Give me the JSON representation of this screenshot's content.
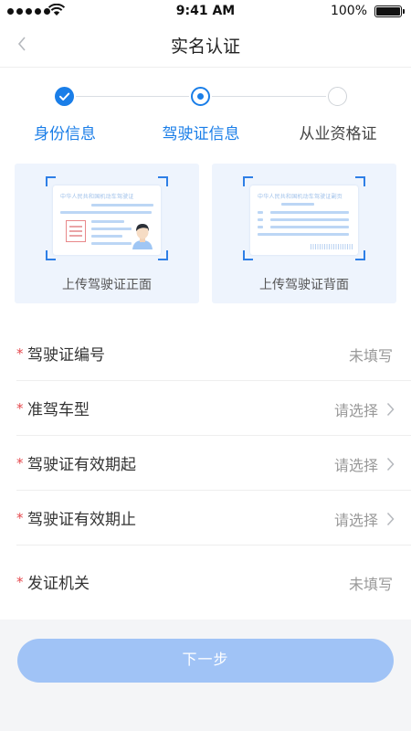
{
  "status_bar": {
    "time": "9:41 AM",
    "battery_text": "100%",
    "battery_level": 1.0,
    "signal_icon": "signal-dots-icon",
    "wifi_icon": "wifi-icon"
  },
  "nav": {
    "title": "实名认证",
    "back_icon": "chevron-left-icon"
  },
  "steps": [
    {
      "label": "身份信息",
      "state": "done"
    },
    {
      "label": "驾驶证信息",
      "state": "current"
    },
    {
      "label": "从业资格证",
      "state": "todo"
    }
  ],
  "uploads": {
    "front_label": "上传驾驶证正面",
    "back_label": "上传驾驶证背面",
    "front_card_title": "中华人民共和国机动车驾驶证",
    "back_card_title": "中华人民共和国机动车驾驶证副页"
  },
  "form": {
    "required_mark": "*",
    "rows": [
      {
        "label": "驾驶证编号",
        "value": "未填写"
      },
      {
        "label": "准驾车型",
        "value": "请选择"
      },
      {
        "label": "驾驶证有效期起",
        "value": "请选择"
      },
      {
        "label": "驾驶证有效期止",
        "value": "请选择"
      },
      {
        "label": "发证机关",
        "value": "未填写"
      }
    ]
  },
  "next_button": {
    "label": "下一步"
  },
  "colors": {
    "primary": "#1a7ee8",
    "button_disabled": "#a0c3f6",
    "required": "#e5484d",
    "upload_bg": "#eef4fd",
    "placeholder": "#999999"
  }
}
